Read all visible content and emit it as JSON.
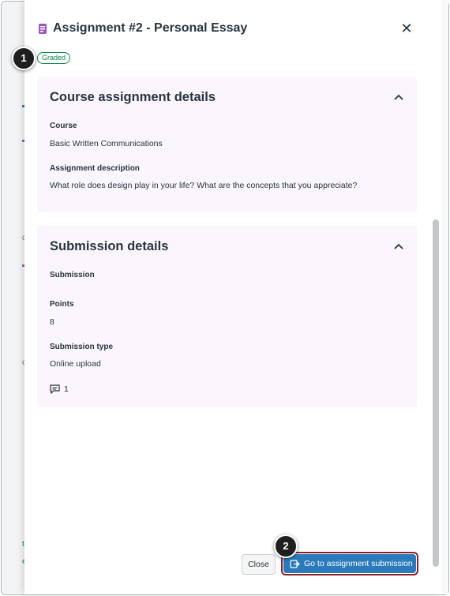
{
  "tray": {
    "title": "Assignment #2 - Personal Essay",
    "status_badge": "Graded"
  },
  "callouts": [
    "1",
    "2"
  ],
  "course_card": {
    "heading": "Course assignment details",
    "course_label": "Course",
    "course_value": "Basic Written Communications",
    "description_label": "Assignment description",
    "description_value": "What role does design play in your life? What are the concepts that you appreciate?"
  },
  "submission_card": {
    "heading": "Submission details",
    "submission_label": "Submission",
    "points_label": "Points",
    "points_value": "8",
    "type_label": "Submission type",
    "type_value": "Online upload",
    "comment_count": "1"
  },
  "footer": {
    "close_label": "Close",
    "go_label": "Go to assignment submission"
  },
  "background": {
    "letters": [
      "d",
      "d",
      "t",
      "e"
    ]
  },
  "icons": {
    "header": "assignment-icon",
    "close": "close-icon",
    "collapse": "chevron-up-icon",
    "comment": "comment-icon",
    "external": "external-link-icon"
  },
  "colors": {
    "accent": "#2b7abc",
    "graded_green": "#0b874b",
    "card_bg": "#fbf5fd",
    "highlight_border": "#8b1f2a",
    "icon_purple": "#9e58bd"
  }
}
